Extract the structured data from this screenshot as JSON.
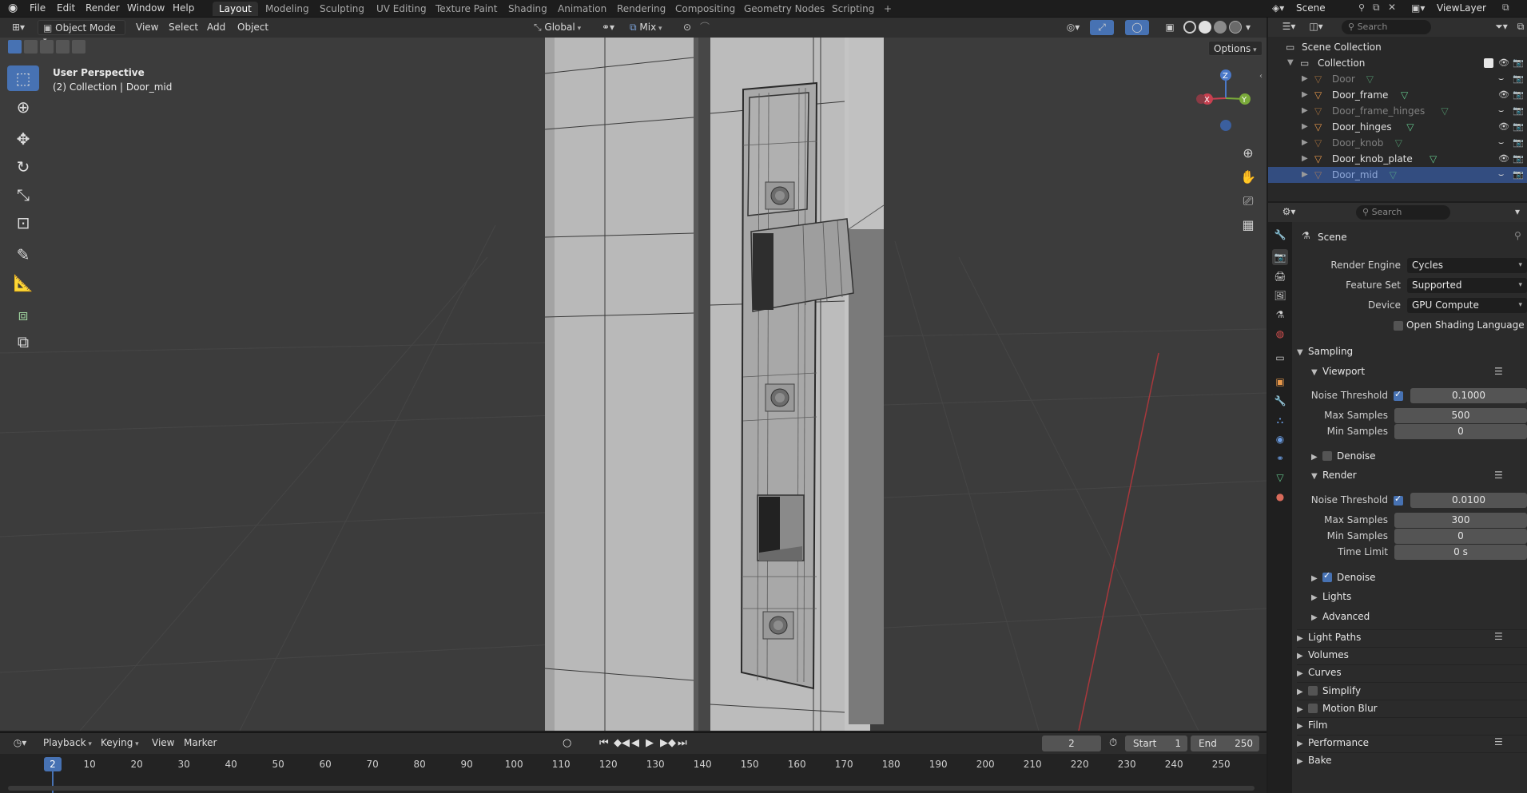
{
  "topbar": {
    "menus": [
      "File",
      "Edit",
      "Render",
      "Window",
      "Help"
    ],
    "workspaces": [
      "Layout",
      "Modeling",
      "Sculpting",
      "UV Editing",
      "Texture Paint",
      "Shading",
      "Animation",
      "Rendering",
      "Compositing",
      "Geometry Nodes",
      "Scripting"
    ],
    "add_tab": "+",
    "scene": "Scene",
    "view_layer": "ViewLayer"
  },
  "viewport": {
    "mode": "Object Mode",
    "menus": [
      "View",
      "Select",
      "Add",
      "Object"
    ],
    "transform_orientation": "Global",
    "snap_mode": "Mix",
    "options": "Options",
    "perspective": "User Perspective",
    "context": "(2) Collection | Door_mid",
    "gizmo": {
      "z": "Z",
      "x": "X",
      "y": "Y"
    }
  },
  "timeline": {
    "menus": [
      "Playback",
      "Keying",
      "View",
      "Marker"
    ],
    "current_frame": "2",
    "start_label": "Start",
    "start": "1",
    "end_label": "End",
    "end": "250",
    "ruler": [
      "10",
      "20",
      "30",
      "40",
      "50",
      "60",
      "70",
      "80",
      "90",
      "100",
      "110",
      "120",
      "130",
      "140",
      "150",
      "160",
      "170",
      "180",
      "190",
      "200",
      "210",
      "220",
      "230",
      "240",
      "250"
    ],
    "playhead": "2"
  },
  "outliner": {
    "search_placeholder": "Search",
    "scene_collection": "Scene Collection",
    "collection": "Collection",
    "items": [
      {
        "name": "Door",
        "dim": true,
        "visible": false
      },
      {
        "name": "Door_frame",
        "dim": false,
        "visible": true
      },
      {
        "name": "Door_frame_hinges",
        "dim": true,
        "visible": false
      },
      {
        "name": "Door_hinges",
        "dim": false,
        "visible": true
      },
      {
        "name": "Door_knob",
        "dim": true,
        "visible": false
      },
      {
        "name": "Door_knob_plate",
        "dim": false,
        "visible": true
      },
      {
        "name": "Door_mid",
        "dim": true,
        "visible": false,
        "selected": true
      }
    ]
  },
  "properties": {
    "search_placeholder": "Search",
    "context": "Scene",
    "render_engine_label": "Render Engine",
    "render_engine": "Cycles",
    "feature_set_label": "Feature Set",
    "feature_set": "Supported",
    "device_label": "Device",
    "device": "GPU Compute",
    "osl_label": "Open Shading Language",
    "sampling": "Sampling",
    "viewport": {
      "title": "Viewport",
      "noise_threshold_label": "Noise Threshold",
      "noise_threshold": "0.1000",
      "max_samples_label": "Max Samples",
      "max_samples": "500",
      "min_samples_label": "Min Samples",
      "min_samples": "0",
      "denoise_label": "Denoise"
    },
    "render": {
      "title": "Render",
      "noise_threshold_label": "Noise Threshold",
      "noise_threshold": "0.0100",
      "max_samples_label": "Max Samples",
      "max_samples": "300",
      "min_samples_label": "Min Samples",
      "min_samples": "0",
      "time_limit_label": "Time Limit",
      "time_limit": "0 s",
      "denoise_label": "Denoise"
    },
    "subsections": [
      "Lights",
      "Advanced"
    ],
    "panels": [
      "Light Paths",
      "Volumes",
      "Curves",
      "Simplify",
      "Motion Blur",
      "Film",
      "Performance",
      "Bake"
    ]
  }
}
